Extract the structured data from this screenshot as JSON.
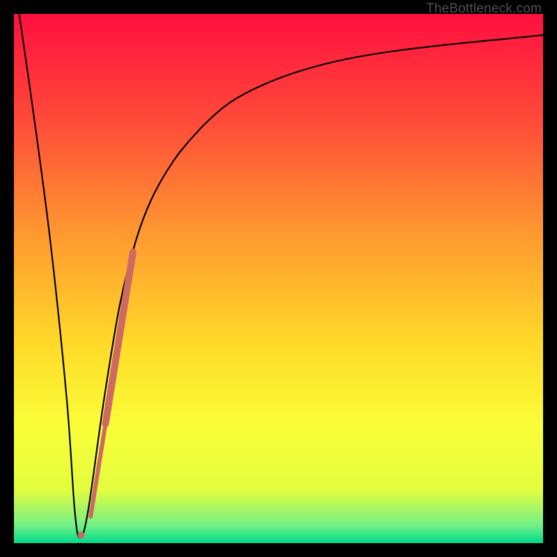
{
  "watermark": "TheBottleneck.com",
  "chart_data": {
    "type": "line",
    "title": "",
    "xlabel": "",
    "ylabel": "",
    "xlim": [
      0,
      100
    ],
    "ylim": [
      0,
      100
    ],
    "grid": false,
    "legend": false,
    "gradient_stops": [
      {
        "offset": 0.0,
        "color": "#ff0f3f"
      },
      {
        "offset": 0.2,
        "color": "#ff4a39"
      },
      {
        "offset": 0.42,
        "color": "#ff9a30"
      },
      {
        "offset": 0.62,
        "color": "#ffd929"
      },
      {
        "offset": 0.78,
        "color": "#fafe38"
      },
      {
        "offset": 0.9,
        "color": "#e2fd3f"
      },
      {
        "offset": 0.965,
        "color": "#77f086"
      },
      {
        "offset": 1.0,
        "color": "#00db8e"
      }
    ],
    "series": [
      {
        "name": "bottleneck-curve",
        "color": "#000000",
        "weight": 2,
        "x": [
          1,
          4,
          7,
          10,
          11.5,
          12.5,
          14,
          17,
          20,
          23,
          26,
          30,
          34,
          38,
          42,
          48,
          55,
          63,
          72,
          82,
          92,
          100
        ],
        "y": [
          100,
          79,
          56,
          27,
          6,
          1,
          6,
          27,
          45,
          57,
          65,
          72,
          77,
          81,
          84,
          87,
          89.5,
          91.5,
          93,
          94.2,
          95.2,
          96
        ]
      },
      {
        "name": "highlight-segment",
        "color": "#cf6a62",
        "weight_top": 10,
        "weight_bottom": 6,
        "x": [
          14.5,
          22.5
        ],
        "y": [
          5,
          55
        ]
      },
      {
        "name": "highlight-dot",
        "color": "#cf6a62",
        "x": [
          12.7
        ],
        "y": [
          1.5
        ],
        "r": 5
      }
    ]
  }
}
